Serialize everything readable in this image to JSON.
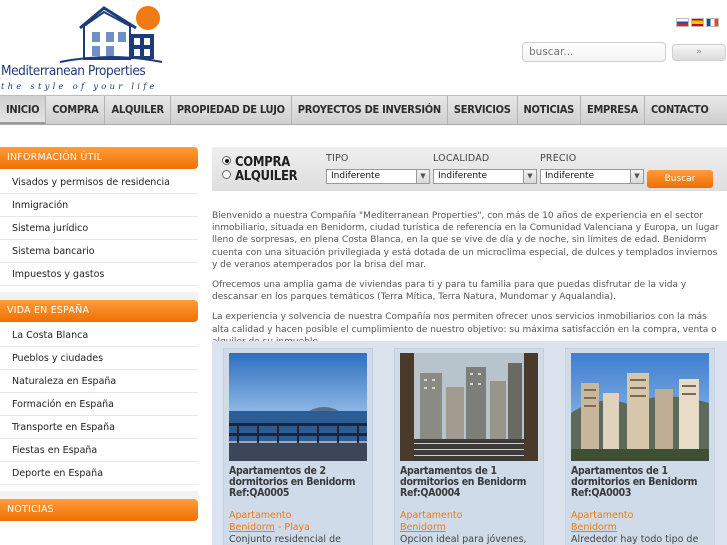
{
  "header": {
    "logo_name": "Mediterranean Properties",
    "logo_tagline": "the style of your life",
    "search_placeholder": "buscar...",
    "search_button_label": "»",
    "languages": [
      "ru",
      "es",
      "fr"
    ]
  },
  "nav": {
    "items": [
      "INICIO",
      "COMPRA",
      "ALQUILER",
      "PROPIEDAD DE LUJO",
      "PROYECTOS DE INVERSIÓN",
      "SERVICIOS",
      "NOTICIAS",
      "EMPRESA",
      "CONTACTO"
    ],
    "active": "INICIO"
  },
  "sidebar": {
    "sections": [
      {
        "title": "INFORMACIÓN ÚTIL",
        "items": [
          "Visados y permisos de residencia",
          "Inmigración",
          "Sistema jurídico",
          "Sistema bancario",
          "Impuestos y gastos"
        ]
      },
      {
        "title": "VIDA EN ESPAÑA",
        "items": [
          "La Costa Blanca",
          "Pueblos y ciudades",
          "Naturaleza en España",
          "Formación en España",
          "Transporte en España",
          "Fiestas en España",
          "Deporte en España"
        ]
      },
      {
        "title": "NOTICIAS",
        "items": []
      }
    ]
  },
  "search_form": {
    "radio_options": [
      "COMPRA",
      "ALQUILER"
    ],
    "selected_radio": "COMPRA",
    "fields": [
      {
        "label": "TIPO",
        "value": "Indiferente"
      },
      {
        "label": "LOCALIDAD",
        "value": "Indiferente"
      },
      {
        "label": "PRECIO",
        "value": "Indiferente"
      }
    ],
    "button_label": "Buscar",
    "accent_color": "#f07a14"
  },
  "intro": {
    "paragraphs": [
      "Bienvenido a nuestra Compañía \"Mediterranean Properties\", con más de 10 años de experiencia en el sector inmobiliario, situada en Benidorm, ciudad  turística de referencia en la Comunidad Valenciana y Europa,  un lugar lleno de sorpresas, en plena Costa Blanca, en la que se vive de día y de noche, sin límites de edad. Benidorm cuenta con una situación privilegiada y está dotada de un microclima especial, de dulces y templados inviernos y de veranos atemperados por la brisa del mar.",
      "Ofrecemos una amplia gama de viviendas para ti y para tu familia para que puedas disfrutar de la vida y descansar en los parques temáticos  (Terra Mítica, Terra Natura, Mundomar y Aqualandia).",
      "La experiencia y solvencia de nuestra Compañía nos permiten ofrecer unos servicios inmobiliarios con la más alta calidad y hacen posible el cumplimiento de nuestro objetivo: su máxima satisfacción en la compra, venta o alquiler de su inmueble."
    ]
  },
  "listings": [
    {
      "title": "Apartamentos de 2 dormitorios en Benidorm Ref:QA0005",
      "type": "Apartamento",
      "city": "Benidorm",
      "zone": "- Playa",
      "description": "Conjunto residencial de apartamentos en primera línea de"
    },
    {
      "title": "Apartamentos de 1 dormitorios en Benidorm Ref:QA0004",
      "type": "Apartamento",
      "city": "Benidorm",
      "zone": "",
      "description": "Opcion ideal para jóvenes, familias con hijos o personas"
    },
    {
      "title": "Apartamentos de 1 dormitorios en Benidorm Ref:QA0003",
      "type": "Apartamento",
      "city": "Benidorm",
      "zone": "",
      "description": "Alrededor hay todo tipo de comercios, restaurantes, tiendas y"
    }
  ]
}
